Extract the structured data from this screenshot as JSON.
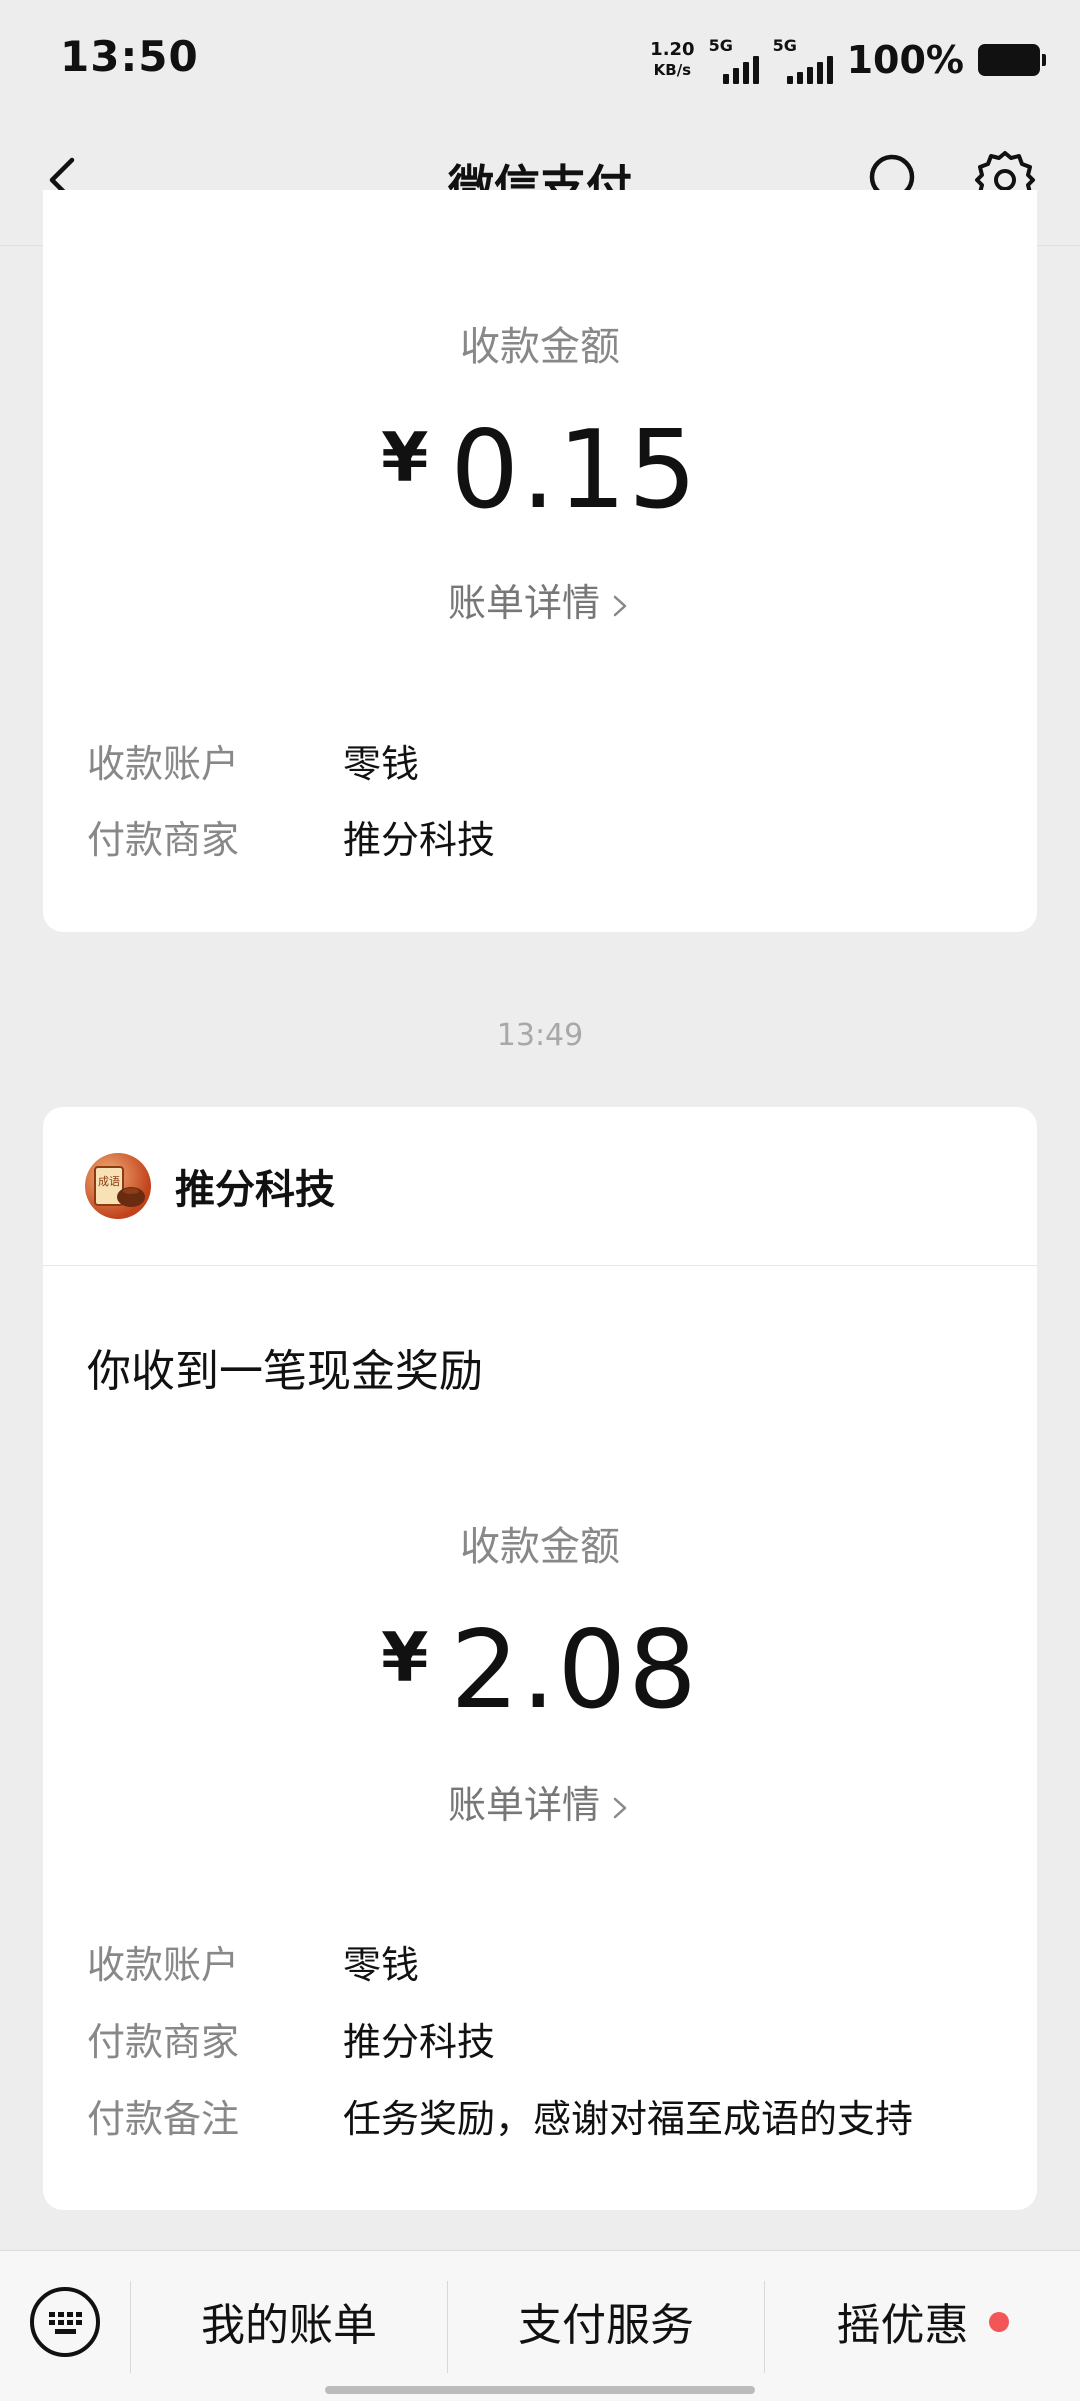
{
  "status_bar": {
    "time": "13:50",
    "net_speed_value": "1.20",
    "net_speed_unit": "KB/s",
    "sim1_label": "5G",
    "sim2_label": "5G",
    "battery": "100%"
  },
  "nav": {
    "title": "微信支付"
  },
  "card1": {
    "amount_label": "收款金额",
    "currency": "¥",
    "amount": "0.15",
    "bill_link": "账单详情",
    "rows": [
      {
        "key": "收款账户",
        "value": "零钱"
      },
      {
        "key": "付款商家",
        "value": "推分科技"
      }
    ]
  },
  "divider_time": "13:49",
  "card2": {
    "merchant_name": "推分科技",
    "avatar_text": "成语",
    "message_title": "你收到一笔现金奖励",
    "amount_label": "收款金额",
    "currency": "¥",
    "amount": "2.08",
    "bill_link": "账单详情",
    "rows": [
      {
        "key": "收款账户",
        "value": "零钱"
      },
      {
        "key": "付款商家",
        "value": "推分科技"
      },
      {
        "key": "付款备注",
        "value": "任务奖励，感谢对福至成语的支持"
      }
    ]
  },
  "bottom_bar": {
    "tabs": [
      "我的账单",
      "支付服务",
      "摇优惠"
    ],
    "badge_color": "#f25656"
  }
}
